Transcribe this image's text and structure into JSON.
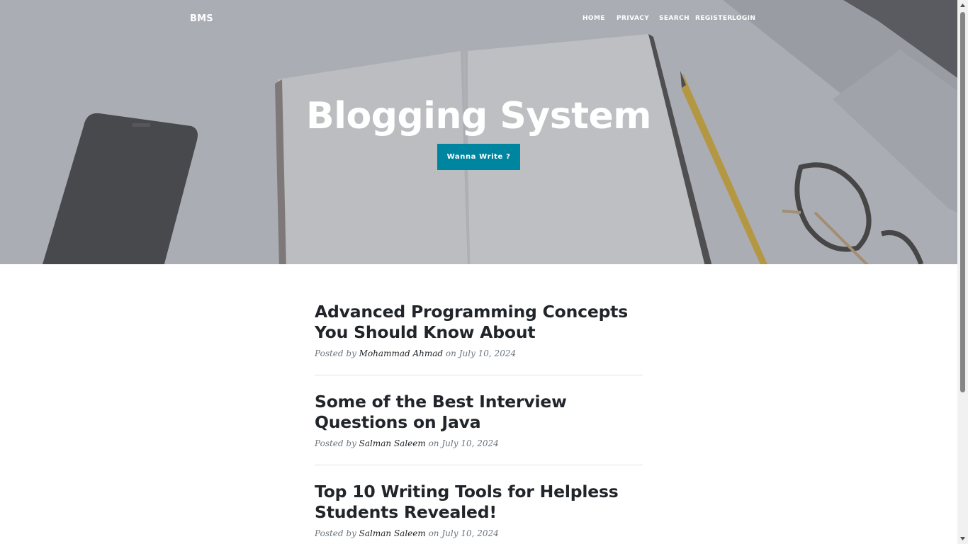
{
  "brand": "BMS",
  "nav": [
    {
      "label": "HOME"
    },
    {
      "label": "PRIVACY"
    },
    {
      "label": "SEARCH"
    },
    {
      "label": "REGISTER"
    },
    {
      "label": "LOGIN"
    }
  ],
  "hero": {
    "title": "Blogging System",
    "cta_label": "Wanna Write ?"
  },
  "posts": [
    {
      "title": "Advanced Programming Concepts You Should Know About",
      "meta_prefix": "Posted by ",
      "author": "Mohammad Ahmad",
      "meta_mid": " on ",
      "date": "July 10, 2024"
    },
    {
      "title": "Some of the Best Interview Questions on Java",
      "meta_prefix": "Posted by ",
      "author": "Salman Saleem",
      "meta_mid": " on ",
      "date": "July 10, 2024"
    },
    {
      "title": "Top 10 Writing Tools for Helpless Students Revealed!",
      "meta_prefix": "Posted by ",
      "author": "Salman Saleem",
      "meta_mid": " on ",
      "date": "July 10, 2024"
    }
  ],
  "colors": {
    "accent": "#0085a1",
    "heading": "#212529",
    "meta": "#6c757d"
  }
}
